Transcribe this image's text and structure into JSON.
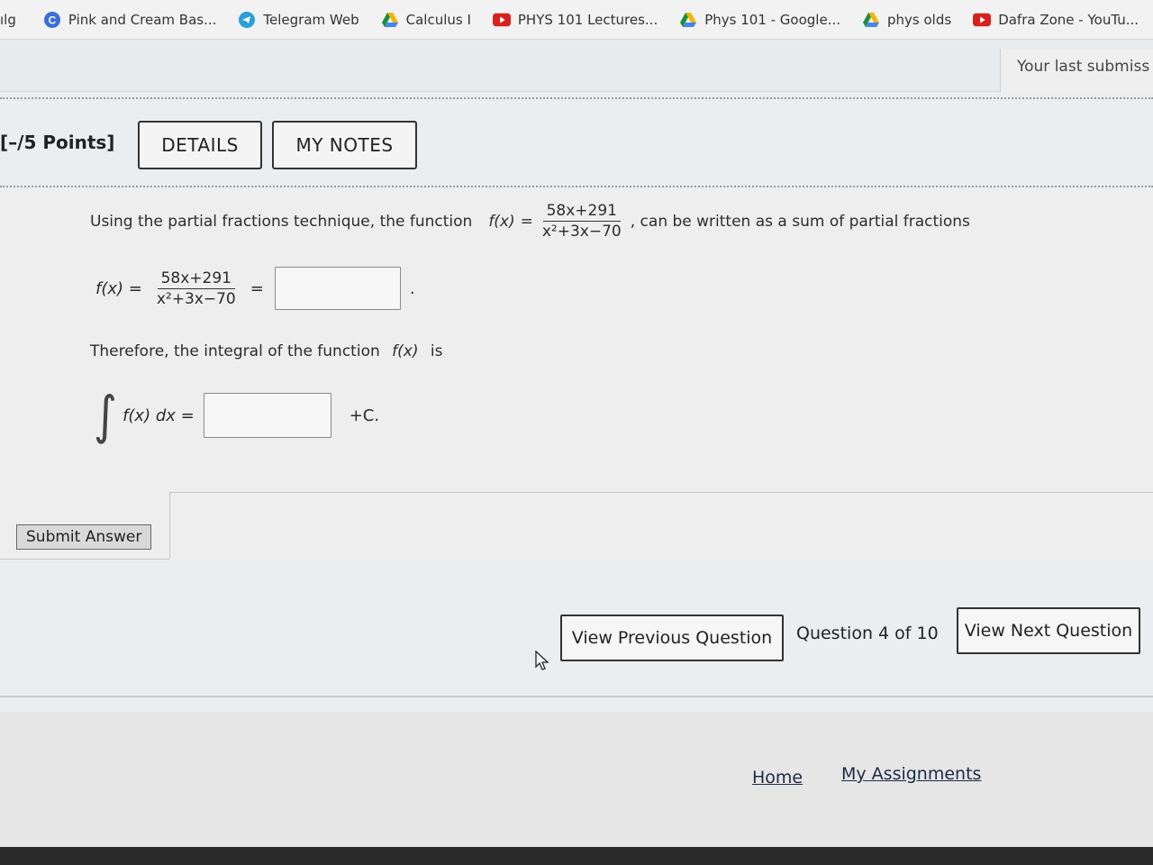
{
  "bookmarks": [
    {
      "label": "Pink and Cream Bas...",
      "icon": "canva-icon"
    },
    {
      "label": "Telegram Web",
      "icon": "telegram-icon"
    },
    {
      "label": "Calculus I",
      "icon": "google-drive-icon"
    },
    {
      "label": "PHYS 101 Lectures...",
      "icon": "youtube-icon"
    },
    {
      "label": "Phys 101 - Google...",
      "icon": "google-drive-icon"
    },
    {
      "label": "phys olds",
      "icon": "google-drive-icon"
    },
    {
      "label": "Dafra Zone - YouTu...",
      "icon": "youtube-icon"
    }
  ],
  "bookmark_stub_left": "ılg",
  "header": {
    "last_submission": "Your last submiss",
    "points": "[–/5 Points]",
    "details_label": "DETAILS",
    "notes_label": "MY NOTES"
  },
  "question": {
    "intro": "Using the partial fractions technique, the function",
    "fx": "f(x)",
    "eq": "=",
    "numerator": "58x+291",
    "denominator": "x²+3x−70",
    "intro_tail": ", can be written as a sum of partial fractions",
    "row2_lhs": "f(x) =",
    "row2_eq": "=",
    "row2_tail": ".",
    "row3_text": "Therefore, the integral of the function",
    "row3_fx": "f(x)",
    "row3_tail": "is",
    "integral_symbol": "∫",
    "integrand": "f(x)  dx =",
    "plus_c": "+C.",
    "submit_label": "Submit Answer"
  },
  "nav": {
    "prev_label": "View Previous Question",
    "counter": "Question 4 of 10",
    "next_label": "View Next Question"
  },
  "footer": {
    "home": "Home",
    "assignments": "My Assignments"
  },
  "colors": {
    "page_bg": "#ecedee",
    "text": "#2b2b2b",
    "youtube_red": "#d8201c",
    "telegram_blue": "#2a9fd8",
    "canva_blue": "#3b6fd8"
  }
}
